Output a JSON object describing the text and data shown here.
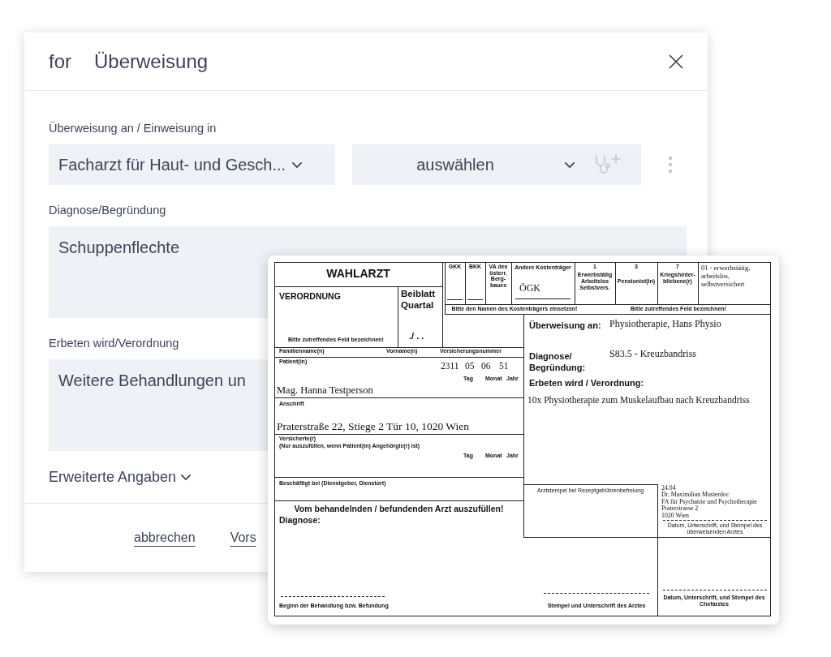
{
  "dialog": {
    "title_prefix": "for",
    "title": "Überweisung",
    "fields": [
      {
        "kind": "selects",
        "label": "Überweisung an / Einweisung in",
        "select_1": "Facharzt für Haut- und Gesch...",
        "select_2": "auswählen"
      },
      {
        "kind": "textarea",
        "label": "Diagnose/Begründung",
        "value": "Schuppenflechte"
      },
      {
        "kind": "textarea",
        "label": "Erbeten wird/Verordnung",
        "value": "Weitere Behandlungen un"
      }
    ],
    "more": {
      "label": "Erweiterte Angaben",
      "expanded": false
    },
    "buttons": [
      "abbrechen",
      "Vors"
    ]
  },
  "form": {
    "title": "WAHLARZT",
    "payers": [
      {
        "label": "GKK",
        "kind": "line"
      },
      {
        "label": "BKK",
        "kind": "line"
      },
      {
        "label": "VA des österr. Berg- baues",
        "kind": "plain"
      }
    ],
    "other_payer_label": "Andere Kostenträger",
    "other_payer": "ÖGK",
    "categories": [
      {
        "number": "1",
        "label": "Erwerbstätig Arbeitslos Selbstvers."
      },
      {
        "number": "3",
        "label": "Pensionist(in)"
      },
      {
        "number": "7",
        "label": "Kriegshinter- bliebene(r)"
      }
    ],
    "category_value": "01 - erwerbstätig, arbeitslos, selbstversichert",
    "payer_hint": "Bitte den Namen des Kostenträgers einsetzen!",
    "category_hint": "Bitte zutreffendes Feld bezeichnen!",
    "order_title": "VERORDNUNG",
    "order_hint": "Bitte zutreffendes Feld bezeichnen!",
    "supplement_title": "Beiblatt Quartal",
    "quarter": "./ . .",
    "name_headers": [
      "Familienname(n)",
      "Vorname(n)",
      "Versicherungsnummer"
    ],
    "patient": {
      "label": "Patient(in)",
      "insurance_number": [
        "2311",
        "05",
        "06",
        "51"
      ],
      "date_labels": [
        "Tag",
        "Monat",
        "Jahr"
      ],
      "name": "Mag. Hanna Testperson"
    },
    "address": {
      "label": "Anschrift",
      "value": "Praterstraße 22, Stiege 2 Tür 10, 1020 Wien"
    },
    "insured": {
      "label": "Versicherte(r)",
      "note": "(Nur auszufüllen, wenn Patient(in) Angehörgie(r) ist)",
      "date_labels": [
        "Tag",
        "Monat",
        "Jahr"
      ]
    },
    "employer": {
      "label": "Beschäftigt bei (Dienstgeber, Dienstort)"
    },
    "referral": {
      "to_label": "Überweisung an:",
      "to": "Physiotherapie, Hans Physio",
      "diagnosis_label": "Diagnose/ Begründung:",
      "diagnosis": "S83.5 - Kreuzbandriss",
      "request_label": "Erbeten wird / Verordnung:",
      "request": "10x Physiotherapie zum Muskelaufbau nach Kreuzbandriss"
    },
    "stamp_label": "Arztstempel bei Rezeptgebührenbefreiung",
    "signature_lines": [
      "24.04",
      "Dr. Maximilian Musterdoc",
      "FA für Psychatrie und Psychotherapie",
      "Praterstrasse 2",
      "1020 Wien"
    ],
    "signature_caption": "Datum, Unterschrift, und Stempel des überweisenden Arztes",
    "treating_title": "Vom behandelnden / befundenden Arzt auszufüllen!",
    "treating_diagnosis_label": "Diagnose:",
    "footer_captions": [
      "Beginn der Behandlung bzw. Befundung",
      "Stempel und Unterschrift des Arztes",
      "Datum, Unterschrift, und Stempel des Chefarztes"
    ]
  }
}
